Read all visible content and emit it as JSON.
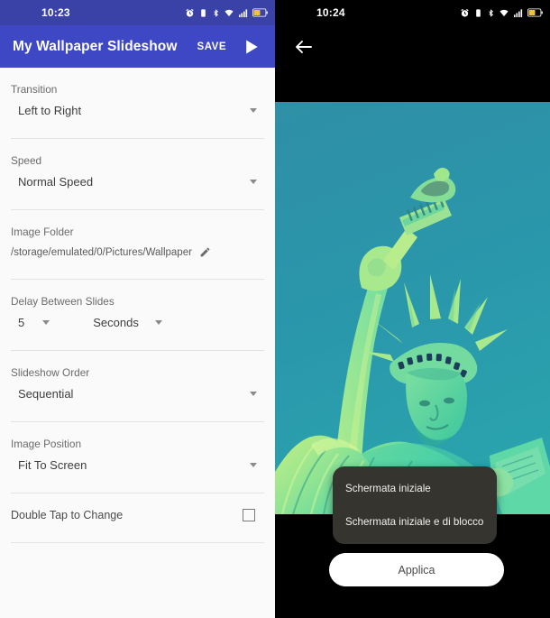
{
  "left": {
    "statusbar": {
      "time": "10:23",
      "icons": [
        "alarm-icon",
        "vibrate-icon",
        "bluetooth-icon",
        "wifi-icon",
        "signal-icon",
        "battery-icon"
      ]
    },
    "appbar": {
      "title": "My Wallpaper Slideshow",
      "save_label": "SAVE",
      "play_icon": "play-icon",
      "bg_color": "#3f48c4"
    },
    "settings": [
      {
        "label": "Transition",
        "value": "Left to Right"
      },
      {
        "label": "Speed",
        "value": "Normal Speed"
      },
      {
        "label": "Image Folder",
        "value": "/storage/emulated/0/Pictures/Wallpaper"
      },
      {
        "label": "Delay Between Slides",
        "value": "5",
        "unit": "Seconds"
      },
      {
        "label": "Slideshow Order",
        "value": "Sequential"
      },
      {
        "label": "Image Position",
        "value": "Fit To Screen"
      },
      {
        "label": "Double Tap to Change",
        "checked": false
      }
    ]
  },
  "right": {
    "statusbar": {
      "time": "10:24",
      "icons": [
        "alarm-icon",
        "vibrate-icon",
        "bluetooth-icon",
        "wifi-icon",
        "signal-icon",
        "battery-icon"
      ]
    },
    "back_icon": "back-arrow-icon",
    "wallpaper": {
      "subject": "statue-of-liberty-photo",
      "sky_color": "#2b94a9",
      "statue_color": "#7fe08a"
    },
    "popup": {
      "items": [
        {
          "label": "Schermata iniziale"
        },
        {
          "label": "Schermata iniziale e di blocco"
        }
      ]
    },
    "apply_button": {
      "label": "Applica"
    }
  }
}
